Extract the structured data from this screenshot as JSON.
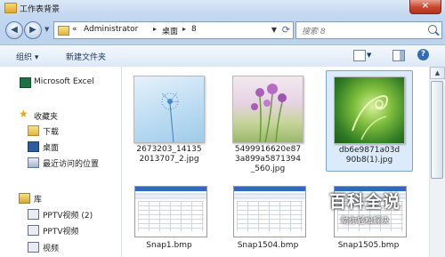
{
  "window": {
    "title": "工作表背景",
    "close_glyph": "×"
  },
  "address": {
    "nav_back": "◀",
    "nav_forward": "▶",
    "prefix": "«",
    "crumbs": [
      "Administrator",
      "桌面",
      "8"
    ],
    "separator": "▸",
    "search_placeholder": "搜索 8"
  },
  "toolbar": {
    "organize": "组织 ▾",
    "new_folder": "新建文件夹"
  },
  "navpane": {
    "items": [
      {
        "label": "Microsoft Excel",
        "icon": "excel-icon"
      },
      {
        "label": "收藏夹",
        "icon": "favorites-star-icon"
      },
      {
        "label": "下载",
        "icon": "download-folder-icon"
      },
      {
        "label": "桌面",
        "icon": "desktop-icon"
      },
      {
        "label": "最近访问的位置",
        "icon": "recent-places-icon"
      },
      {
        "label": "库",
        "icon": "library-icon"
      },
      {
        "label": "PPTV视频 (2)",
        "icon": "video-library-icon"
      },
      {
        "label": "PPTV视频",
        "icon": "video-library-icon"
      },
      {
        "label": "视频",
        "icon": "video-library-icon"
      }
    ]
  },
  "files": [
    {
      "name_lines": [
        "2673203_14135",
        "2013707_2.jpg"
      ],
      "type": "jpg-dandelion"
    },
    {
      "name_lines": [
        "5499916620e87",
        "3a899a5871394",
        "_560.jpg"
      ],
      "type": "jpg-flowers"
    },
    {
      "name_lines": [
        "db6e9871a03d",
        "90b8(1).jpg"
      ],
      "type": "jpg-fern",
      "selected": true
    },
    {
      "name_lines": [
        "Snap1.bmp"
      ],
      "type": "bmp"
    },
    {
      "name_lines": [
        "Snap1504.bmp"
      ],
      "type": "bmp"
    },
    {
      "name_lines": [
        "Snap1505.bmp"
      ],
      "type": "bmp"
    }
  ],
  "watermark": {
    "main": "百科全说",
    "sub": "助你轻松解决"
  },
  "colors": {
    "titlebar": "#c3d7f0",
    "selection": "#dcebfc",
    "close": "#c9452c"
  }
}
